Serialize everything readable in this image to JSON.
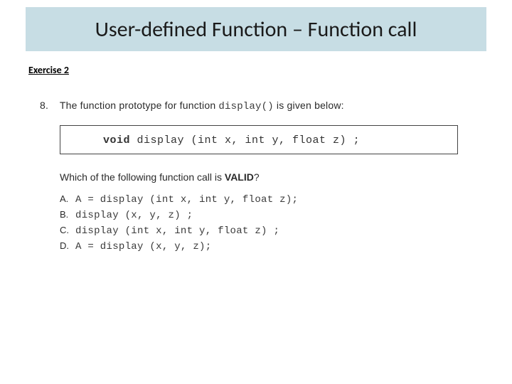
{
  "title": "User-defined Function – Function call",
  "exercise_label": "Exercise 2",
  "question": {
    "number": "8.",
    "lead_in": "The function prototype for function",
    "fn_name": "display()",
    "lead_out": "  is given below:"
  },
  "prototype": {
    "kw": "void",
    "rest": " display (int x, int y, float z) ;"
  },
  "which_prefix": "Which of the following function call is ",
  "which_valid": "VALID",
  "which_q": "?",
  "options": [
    {
      "letter": "A.",
      "code": "A = display (int x, int y, float z);"
    },
    {
      "letter": "B.",
      "code": "display (x, y, z) ;"
    },
    {
      "letter": "C.",
      "code": "display (int x, int y, float z) ;"
    },
    {
      "letter": "D.",
      "code": "A = display (x, y, z);"
    }
  ]
}
